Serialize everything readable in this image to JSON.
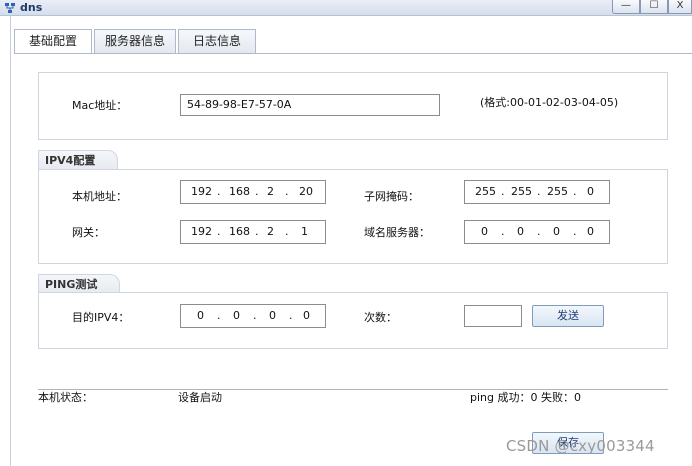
{
  "window": {
    "title": "dns",
    "minimize_glyph": "—",
    "maximize_glyph": "☐",
    "close_glyph": "X",
    "app_icon": "network-icon"
  },
  "tabs": [
    {
      "label": "基础配置",
      "active": true
    },
    {
      "label": "服务器信息",
      "active": false
    },
    {
      "label": "日志信息",
      "active": false
    }
  ],
  "mac": {
    "label": "Mac地址：",
    "value": "54-89-98-E7-57-0A",
    "hint": "(格式:00-01-02-03-04-05)"
  },
  "ipv4": {
    "legend": "IPV4配置",
    "local_address_label": "本机地址：",
    "local_address": [
      "192",
      "168",
      "2",
      "20"
    ],
    "subnet_mask_label": "子网掩码：",
    "subnet_mask": [
      "255",
      "255",
      "255",
      "0"
    ],
    "gateway_label": "网关：",
    "gateway": [
      "192",
      "168",
      "2",
      "1"
    ],
    "dns_label": "域名服务器：",
    "dns": [
      "0",
      "0",
      "0",
      "0"
    ]
  },
  "ping": {
    "legend": "PING测试",
    "target_label": "目的IPV4：",
    "target": [
      "0",
      "0",
      "0",
      "0"
    ],
    "count_label": "次数：",
    "count_value": "",
    "send_button": "发送"
  },
  "status": {
    "label": "本机状态：",
    "value": "设备启动",
    "ping_result": "ping 成功：0 失败：0"
  },
  "save_button": "保存",
  "watermark": "CSDN @cxy003344",
  "colors": {
    "title_text": "#1f3a66",
    "button_text": "#1c3f74",
    "panel_border": "#cfd6e0"
  }
}
